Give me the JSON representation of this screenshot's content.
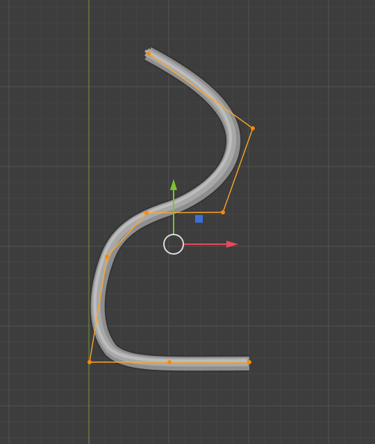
{
  "viewport": {
    "background_color": "#3d3d3d",
    "grid_minor_color": "#464646",
    "grid_major_color": "#535353",
    "y_axis_color": "#6e8a3a"
  },
  "curve": {
    "object_type": "bezier-curve-tube",
    "tube_color": "#9a9a9a",
    "edit_mode": true,
    "control_polygon_color": "#ffa726",
    "control_point_color": "#ff8a00"
  },
  "gizmo": {
    "x_axis_color": "#e84a5f",
    "y_axis_color": "#7cc32e",
    "plane_handle_color": "#3d6fd6",
    "center_ring_color": "#dcdcdc"
  }
}
